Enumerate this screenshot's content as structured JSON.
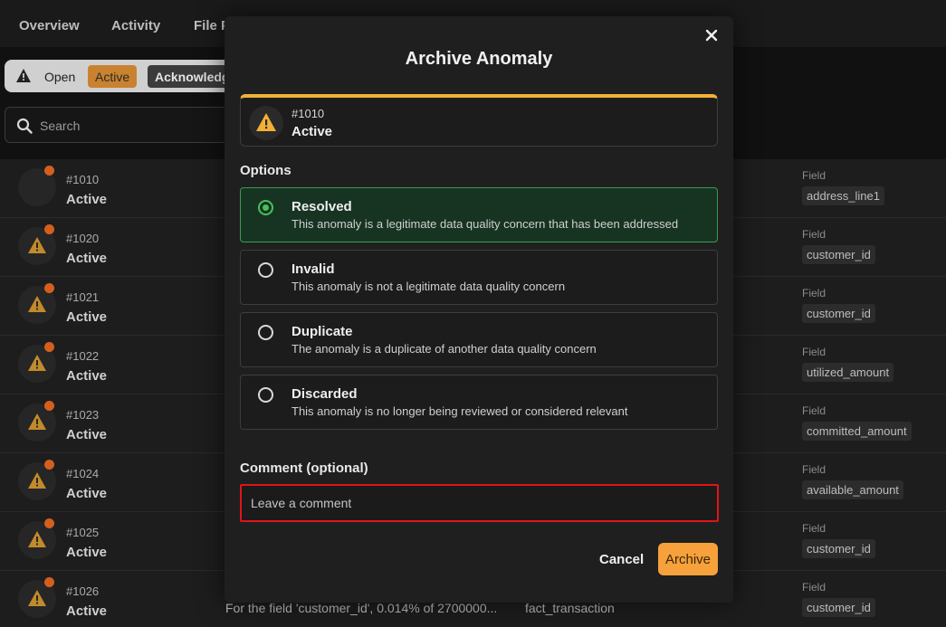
{
  "nav": {
    "tabs": [
      "Overview",
      "Activity",
      "File P"
    ]
  },
  "filters": {
    "open": "Open",
    "active": "Active",
    "acknowledged": "Acknowledg"
  },
  "search": {
    "placeholder": "Search"
  },
  "rows": [
    {
      "id": "#1010",
      "status": "Active",
      "field_label": "Field",
      "field": "address_line1"
    },
    {
      "id": "#1020",
      "status": "Active",
      "field_label": "Field",
      "field": "customer_id"
    },
    {
      "id": "#1021",
      "status": "Active",
      "field_label": "Field",
      "field": "customer_id"
    },
    {
      "id": "#1022",
      "status": "Active",
      "field_label": "Field",
      "field": "utilized_amount"
    },
    {
      "id": "#1023",
      "status": "Active",
      "field_label": "Field",
      "field": "committed_amount"
    },
    {
      "id": "#1024",
      "status": "Active",
      "field_label": "Field",
      "field": "available_amount"
    },
    {
      "id": "#1025",
      "status": "Active",
      "field_label": "Field",
      "field": "customer_id"
    },
    {
      "id": "#1026",
      "status": "Active",
      "field_label": "Field",
      "field": "customer_id"
    }
  ],
  "last_row": {
    "description": "For the field 'customer_id', 0.014% of 2700000...",
    "table": "fact_transaction"
  },
  "modal": {
    "title": "Archive Anomaly",
    "anomaly": {
      "id": "#1010",
      "status": "Active"
    },
    "options_label": "Options",
    "options": [
      {
        "name": "Resolved",
        "description": "This anomaly is a legitimate data quality concern that has been addressed",
        "selected": true
      },
      {
        "name": "Invalid",
        "description": "This anomaly is not a legitimate data quality concern",
        "selected": false
      },
      {
        "name": "Duplicate",
        "description": "The anomaly is a duplicate of another data quality concern",
        "selected": false
      },
      {
        "name": "Discarded",
        "description": "This anomaly is no longer being reviewed or considered relevant",
        "selected": false
      }
    ],
    "comment_label": "Comment (optional)",
    "comment_placeholder": "Leave a comment",
    "comment_value": "",
    "cancel_label": "Cancel",
    "archive_label": "Archive"
  },
  "colors": {
    "accent": "#f6a13b",
    "warning": "#f2b136",
    "selected_border": "#3c9b4c",
    "selected_bg": "#173423",
    "focus_border": "#e0141a",
    "status_dot": "#d35f1f"
  },
  "icons": [
    "warning-icon",
    "search-icon",
    "close-icon"
  ]
}
